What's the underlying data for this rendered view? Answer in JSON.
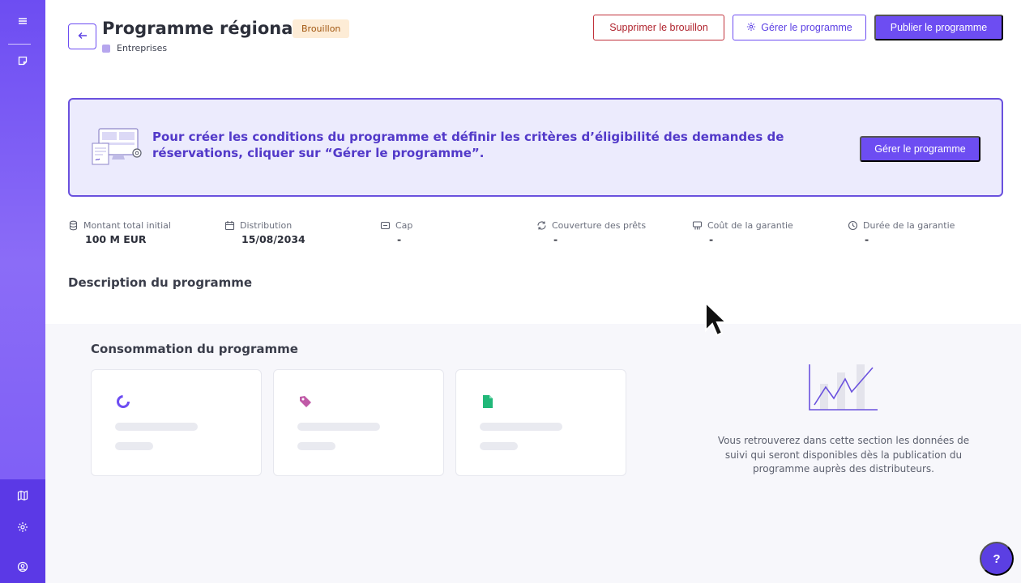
{
  "sidebar": {
    "top_icons": [
      "menu-icon",
      "note-icon"
    ],
    "bottom_icons": [
      "map-icon",
      "gear-icon",
      "user-circle-icon"
    ]
  },
  "header": {
    "back_icon": "arrow-left-icon",
    "title": "Programme régional",
    "status_badge": "Brouillon",
    "subtitle": "Entreprises",
    "buttons": {
      "delete_draft": "Supprimer le brouillon",
      "manage": "Gérer le programme",
      "publish": "Publier le programme"
    }
  },
  "banner": {
    "text": "Pour créer les conditions du programme et définir les critères d’éligibilité des demandes de réservations, cliquer sur “Gérer le programme”.",
    "button": "Gérer le programme"
  },
  "stats": [
    {
      "icon": "database-icon",
      "label": "Montant total initial",
      "value": "100 M EUR"
    },
    {
      "icon": "calendar-icon",
      "label": "Distribution",
      "value": "15/08/2034"
    },
    {
      "icon": "cap-icon",
      "label": "Cap",
      "value": "-"
    },
    {
      "icon": "refresh-icon",
      "label": "Couverture des prêts",
      "value": "-"
    },
    {
      "icon": "cost-icon",
      "label": "Coût de la garantie",
      "value": "-"
    },
    {
      "icon": "clock-icon",
      "label": "Durée de la garantie",
      "value": "-"
    }
  ],
  "description": {
    "title": "Description du programme"
  },
  "consumption": {
    "title": "Consommation du programme",
    "cards": [
      {
        "icon": "progress-icon",
        "color": "#6d4df2"
      },
      {
        "icon": "tag-icon",
        "color": "#c05aa7"
      },
      {
        "icon": "document-icon",
        "color": "#21b879"
      }
    ],
    "placeholder_text": "Vous retrouverez dans cette section les données de suivi qui seront disponibles dès la publication du programme auprès des distributeurs."
  },
  "help": {
    "label": "?"
  },
  "colors": {
    "primary": "#6d4df2",
    "danger": "#c0303a",
    "badge_bg": "#fdecd6",
    "banner_bg": "#ecebfd"
  }
}
